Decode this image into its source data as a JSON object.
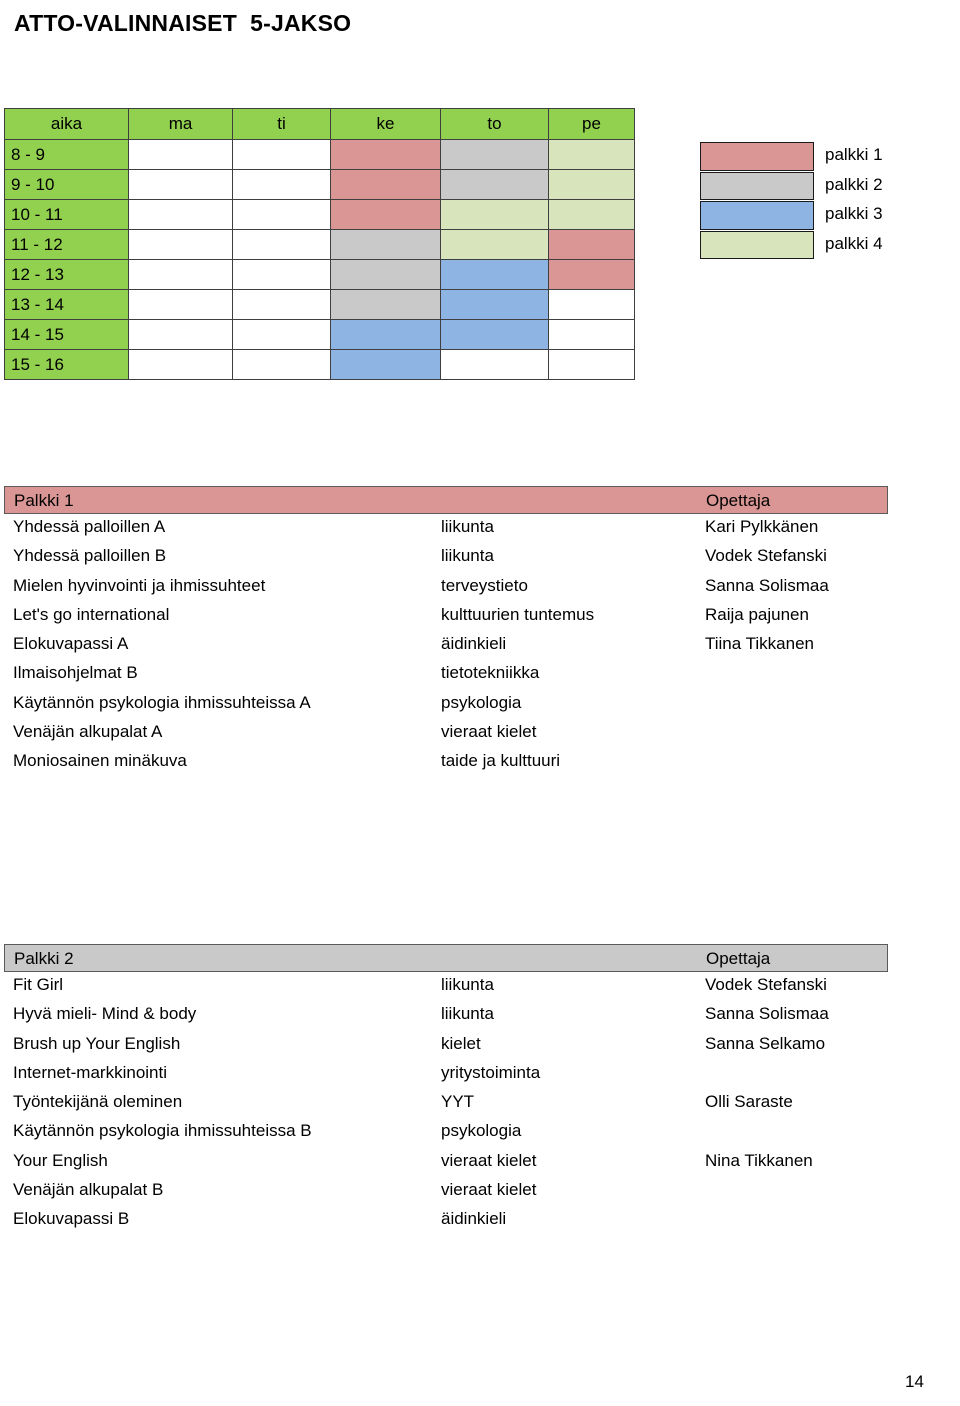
{
  "document": {
    "title": "ATTO-VALINNAISET  5-JAKSO",
    "page_number": "14"
  },
  "colors": {
    "header_green": "#92D050",
    "palkki1": "#D99694",
    "palkki2": "#C9C9C9",
    "palkki3": "#8EB4E3",
    "palkki4": "#D8E4BC",
    "empty": "#FFFFFF"
  },
  "timetable": {
    "columns": [
      "aika",
      "ma",
      "ti",
      "ke",
      "to",
      "pe"
    ],
    "rows": [
      {
        "time": "8 - 9",
        "cells": [
          "empty",
          "empty",
          "p1",
          "p2",
          "p4"
        ]
      },
      {
        "time": "9 - 10",
        "cells": [
          "empty",
          "empty",
          "p1",
          "p2",
          "p4"
        ]
      },
      {
        "time": "10 - 11",
        "cells": [
          "empty",
          "empty",
          "p1",
          "p4",
          "p4"
        ]
      },
      {
        "time": "11 - 12",
        "cells": [
          "empty",
          "empty",
          "p2",
          "p4",
          "p1"
        ]
      },
      {
        "time": "12 - 13",
        "cells": [
          "empty",
          "empty",
          "p2",
          "p3",
          "p1"
        ]
      },
      {
        "time": "13 - 14",
        "cells": [
          "empty",
          "empty",
          "p2",
          "p3",
          "empty"
        ]
      },
      {
        "time": "14 - 15",
        "cells": [
          "empty",
          "empty",
          "p3",
          "p3",
          "empty"
        ]
      },
      {
        "time": "15 - 16",
        "cells": [
          "empty",
          "empty",
          "p3",
          "empty",
          "empty"
        ]
      }
    ]
  },
  "legend": {
    "items": [
      {
        "label": "palkki 1",
        "swatch": "p1"
      },
      {
        "label": "palkki 2",
        "swatch": "p2"
      },
      {
        "label": "palkki 3",
        "swatch": "p3"
      },
      {
        "label": "palkki 4",
        "swatch": "p4"
      }
    ]
  },
  "palkki_tables": [
    {
      "id": "palkki-1",
      "header_style": "h-p1",
      "title": "Palkki 1",
      "teacher_header": "Opettaja",
      "rows": [
        {
          "course": "Yhdessä palloillen A",
          "subject": "liikunta",
          "teacher": "Kari Pylkkänen"
        },
        {
          "course": "Yhdessä palloillen B",
          "subject": "liikunta",
          "teacher": "Vodek Stefanski"
        },
        {
          "course": "Mielen hyvinvointi ja ihmissuhteet",
          "subject": "terveystieto",
          "teacher": "Sanna Solismaa"
        },
        {
          "course": "Let's go international",
          "subject": "kulttuurien tuntemus",
          "teacher": "Raija pajunen"
        },
        {
          "course": "Elokuvapassi A",
          "subject": "äidinkieli",
          "teacher": "Tiina Tikkanen"
        },
        {
          "course": "Ilmaisohjelmat B",
          "subject": "tietotekniikka",
          "teacher": ""
        },
        {
          "course": "Käytännön psykologia ihmissuhteissa A",
          "subject": "psykologia",
          "teacher": ""
        },
        {
          "course": "Venäjän alkupalat A",
          "subject": "vieraat kielet",
          "teacher": ""
        },
        {
          "course": "Moniosainen minäkuva",
          "subject": "taide ja kulttuuri",
          "teacher": ""
        }
      ]
    },
    {
      "id": "palkki-2",
      "header_style": "h-p2",
      "title": "Palkki 2",
      "teacher_header": "Opettaja",
      "rows": [
        {
          "course": "Fit Girl",
          "subject": "liikunta",
          "teacher": "Vodek Stefanski"
        },
        {
          "course": "Hyvä mieli- Mind & body",
          "subject": "liikunta",
          "teacher": "Sanna Solismaa"
        },
        {
          "course": "Brush up Your English",
          "subject": "kielet",
          "teacher": "Sanna Selkamo"
        },
        {
          "course": "Internet-markkinointi",
          "subject": "yritystoiminta",
          "teacher": ""
        },
        {
          "course": "Työntekijänä oleminen",
          "subject": "YYT",
          "teacher": "Olli Saraste"
        },
        {
          "course": "Käytännön psykologia ihmissuhteissa B",
          "subject": "psykologia",
          "teacher": ""
        },
        {
          "course": "Your English",
          "subject": "vieraat kielet",
          "teacher": "Nina Tikkanen"
        },
        {
          "course": "Venäjän alkupalat B",
          "subject": "vieraat kielet",
          "teacher": ""
        },
        {
          "course": "Elokuvapassi B",
          "subject": "äidinkieli",
          "teacher": ""
        }
      ]
    }
  ]
}
